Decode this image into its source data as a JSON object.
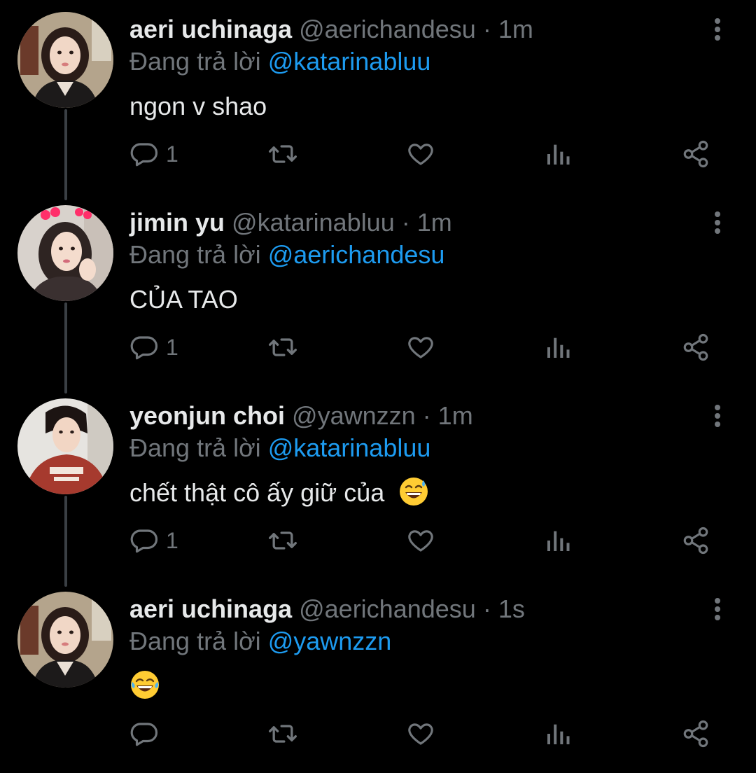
{
  "colors": {
    "background": "#000000",
    "primary_text": "#e7e9ea",
    "secondary_text": "#71767b",
    "accent": "#1d9bf0",
    "thread_line": "#3a3f44"
  },
  "tweets": [
    {
      "display_name": "aeri uchinaga",
      "handle": "@aerichandesu",
      "separator": "·",
      "time": "1m",
      "reply_prefix": "Đang trả lời",
      "reply_to": "@katarinabluu",
      "text": "ngon v shao",
      "emoji": "",
      "reply_count": "1",
      "avatar_icon": "avatar-photo"
    },
    {
      "display_name": "jimin yu",
      "handle": "@katarinabluu",
      "separator": "·",
      "time": "1m",
      "reply_prefix": "Đang trả lời",
      "reply_to": "@aerichandesu",
      "text": "CỦA TAO",
      "emoji": "",
      "reply_count": "1",
      "avatar_icon": "avatar-photo"
    },
    {
      "display_name": "yeonjun choi",
      "handle": "@yawnzzn",
      "separator": "·",
      "time": "1m",
      "reply_prefix": "Đang trả lời",
      "reply_to": "@katarinabluu",
      "text": "chết thật cô ấy giữ của ",
      "emoji": "grinning-sweat-emoji",
      "reply_count": "1",
      "avatar_icon": "avatar-photo"
    },
    {
      "display_name": "aeri uchinaga",
      "handle": "@aerichandesu",
      "separator": "·",
      "time": "1s",
      "reply_prefix": "Đang trả lời",
      "reply_to": "@yawnzzn",
      "text": "",
      "emoji": "tears-of-joy-emoji",
      "reply_count": "",
      "avatar_icon": "avatar-photo"
    }
  ],
  "action_icons": [
    "reply-icon",
    "retweet-icon",
    "like-icon",
    "analytics-icon",
    "share-icon"
  ],
  "menu_icon": "more-vertical-icon"
}
